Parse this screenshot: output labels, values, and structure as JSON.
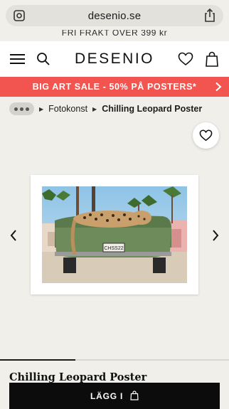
{
  "browser": {
    "url": "desenio.se"
  },
  "shipping_banner": "FRI FRAKT ÖVER 399 kr",
  "header": {
    "logo": "DESENIO"
  },
  "sale_banner": {
    "text": "BIG ART SALE - 50% PÅ POSTERS*"
  },
  "breadcrumb": {
    "items": [
      "Fotokonst",
      "Chilling Leopard Poster"
    ]
  },
  "product": {
    "title": "Chilling Leopard Poster",
    "image_progress": 0.33,
    "license_plate": "CHSS22"
  },
  "cart": {
    "button_label": "LÄGG I"
  },
  "colors": {
    "sale_red": "#f2554f",
    "button_black": "#0c0c0c",
    "page_bg": "#f1efea"
  }
}
